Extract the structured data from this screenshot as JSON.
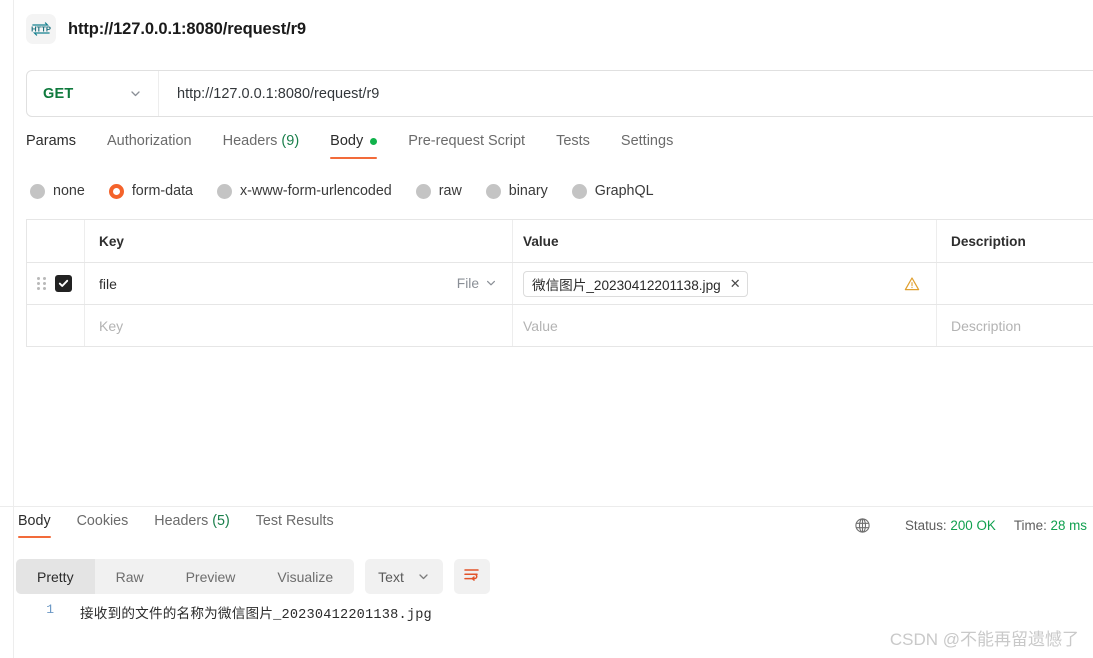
{
  "request": {
    "title": "http://127.0.0.1:8080/request/r9",
    "icon": "http-icon",
    "method": "GET",
    "url": "http://127.0.0.1:8080/request/r9",
    "tabs": [
      {
        "label": "Params",
        "count": "",
        "active": false,
        "dot": false
      },
      {
        "label": "Authorization",
        "count": "",
        "active": false,
        "dot": false
      },
      {
        "label": "Headers",
        "count": "(9)",
        "active": false,
        "dot": false
      },
      {
        "label": "Body",
        "count": "",
        "active": true,
        "dot": true
      },
      {
        "label": "Pre-request Script",
        "count": "",
        "active": false,
        "dot": false
      },
      {
        "label": "Tests",
        "count": "",
        "active": false,
        "dot": false
      },
      {
        "label": "Settings",
        "count": "",
        "active": false,
        "dot": false
      }
    ],
    "body_types": [
      {
        "label": "none",
        "selected": false
      },
      {
        "label": "form-data",
        "selected": true
      },
      {
        "label": "x-www-form-urlencoded",
        "selected": false
      },
      {
        "label": "raw",
        "selected": false
      },
      {
        "label": "binary",
        "selected": false
      },
      {
        "label": "GraphQL",
        "selected": false
      }
    ],
    "table": {
      "headers": {
        "key": "Key",
        "value": "Value",
        "description": "Description"
      },
      "rows": [
        {
          "checked": true,
          "key": "file",
          "key_type": "File",
          "value_chip": "微信图片_20230412201138.jpg",
          "has_warning": true,
          "description": ""
        }
      ],
      "placeholder_row": {
        "key": "Key",
        "value": "Value",
        "description": "Description"
      }
    }
  },
  "response": {
    "tabs": [
      {
        "label": "Body",
        "count": "",
        "active": true
      },
      {
        "label": "Cookies",
        "count": "",
        "active": false
      },
      {
        "label": "Headers",
        "count": "(5)",
        "active": false
      },
      {
        "label": "Test Results",
        "count": "",
        "active": false
      }
    ],
    "status": {
      "status_label": "Status:",
      "status_value": "200 OK",
      "time_label": "Time:",
      "time_value": "28 ms"
    },
    "format_buttons": [
      {
        "label": "Pretty",
        "active": true
      },
      {
        "label": "Raw",
        "active": false
      },
      {
        "label": "Preview",
        "active": false
      },
      {
        "label": "Visualize",
        "active": false
      }
    ],
    "content_type": "Text",
    "lines": [
      {
        "number": "1",
        "text": "接收到的文件的名称为微信图片_20230412201138.jpg"
      }
    ]
  },
  "watermark": "CSDN @不能再留遗憾了",
  "colors": {
    "accent_orange": "#f26b3a",
    "method_green": "#0f7a3d",
    "status_green": "#10a04f",
    "warning_amber": "#e0a030"
  }
}
